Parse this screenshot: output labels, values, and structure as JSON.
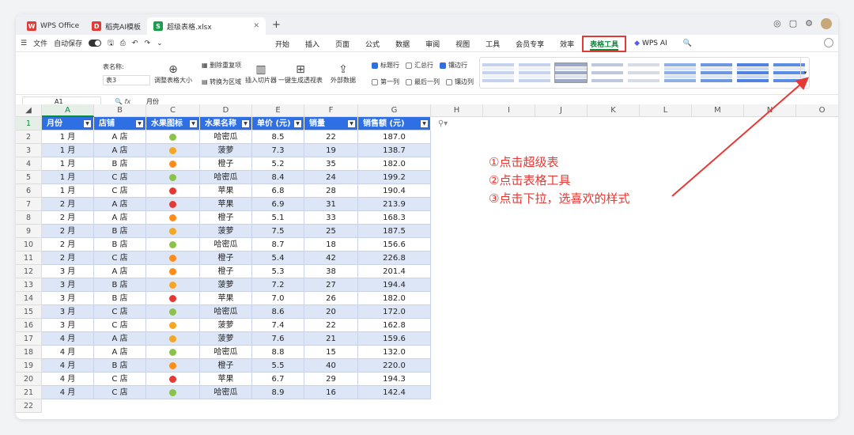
{
  "titlebar": {
    "tabs": [
      {
        "label": "WPS Office",
        "color": "#e53935",
        "logo": "W"
      },
      {
        "label": "稻壳AI模板",
        "color": "#e53935",
        "logo": "D"
      },
      {
        "label": "超级表格.xlsx",
        "color": "#1a9e4a",
        "logo": "S"
      }
    ]
  },
  "menubar": {
    "file": "文件",
    "autosave": "自动保存",
    "menus": [
      "开始",
      "插入",
      "页面",
      "公式",
      "数据",
      "审阅",
      "视图",
      "工具",
      "会员专享",
      "效率",
      "表格工具"
    ],
    "wps_ai": "WPS AI"
  },
  "ribbon": {
    "table_name_label": "表名称:",
    "table_name_value": "表3",
    "resize": "调整表格大小",
    "remove_dup": "删除重复项",
    "to_range": "转换为区域",
    "slicer": "插入切片器",
    "pivot": "一键生成透视表",
    "external": "外部数据",
    "header_row": "标题行",
    "total_row": "汇总行",
    "banded_rows": "镶边行",
    "first_col": "第一列",
    "last_col": "最后一列",
    "banded_cols": "镶边列"
  },
  "formula": {
    "cell_ref": "A1",
    "fx": "fx",
    "value": "月份"
  },
  "columns": [
    "A",
    "B",
    "C",
    "D",
    "E",
    "F",
    "G",
    "H",
    "I",
    "J",
    "K",
    "L",
    "M",
    "N",
    "O"
  ],
  "table": {
    "headers": [
      "月份",
      "店铺",
      "水果图标",
      "水果名称",
      "单价 (元)",
      "销量",
      "销售额 (元)"
    ],
    "rows": [
      [
        "1 月",
        "A 店",
        "pear",
        "哈密瓜",
        "8.5",
        "22",
        "187.0"
      ],
      [
        "1 月",
        "A 店",
        "pineapple",
        "菠萝",
        "7.3",
        "19",
        "138.7"
      ],
      [
        "1 月",
        "B 店",
        "orange",
        "橙子",
        "5.2",
        "35",
        "182.0"
      ],
      [
        "1 月",
        "C 店",
        "pear",
        "哈密瓜",
        "8.4",
        "24",
        "199.2"
      ],
      [
        "1 月",
        "C 店",
        "apple",
        "苹果",
        "6.8",
        "28",
        "190.4"
      ],
      [
        "2 月",
        "A 店",
        "apple",
        "苹果",
        "6.9",
        "31",
        "213.9"
      ],
      [
        "2 月",
        "A 店",
        "orange",
        "橙子",
        "5.1",
        "33",
        "168.3"
      ],
      [
        "2 月",
        "B 店",
        "pineapple",
        "菠萝",
        "7.5",
        "25",
        "187.5"
      ],
      [
        "2 月",
        "B 店",
        "pear",
        "哈密瓜",
        "8.7",
        "18",
        "156.6"
      ],
      [
        "2 月",
        "C 店",
        "orange",
        "橙子",
        "5.4",
        "42",
        "226.8"
      ],
      [
        "3 月",
        "A 店",
        "orange",
        "橙子",
        "5.3",
        "38",
        "201.4"
      ],
      [
        "3 月",
        "B 店",
        "pineapple",
        "菠萝",
        "7.2",
        "27",
        "194.4"
      ],
      [
        "3 月",
        "B 店",
        "apple",
        "苹果",
        "7.0",
        "26",
        "182.0"
      ],
      [
        "3 月",
        "C 店",
        "pear",
        "哈密瓜",
        "8.6",
        "20",
        "172.0"
      ],
      [
        "3 月",
        "C 店",
        "pineapple",
        "菠萝",
        "7.4",
        "22",
        "162.8"
      ],
      [
        "4 月",
        "A 店",
        "pineapple",
        "菠萝",
        "7.6",
        "21",
        "159.6"
      ],
      [
        "4 月",
        "A 店",
        "pear",
        "哈密瓜",
        "8.8",
        "15",
        "132.0"
      ],
      [
        "4 月",
        "B 店",
        "orange",
        "橙子",
        "5.5",
        "40",
        "220.0"
      ],
      [
        "4 月",
        "C 店",
        "apple",
        "苹果",
        "6.7",
        "29",
        "194.3"
      ],
      [
        "4 月",
        "C 店",
        "pear",
        "哈密瓜",
        "8.9",
        "16",
        "142.4"
      ]
    ]
  },
  "fruit_colors": {
    "pear": "#8bc34a",
    "pineapple": "#f5a623",
    "orange": "#ff8c1a",
    "apple": "#e53935"
  },
  "annotations": [
    "①点击超级表",
    "②点击表格工具",
    "③点击下拉，选喜欢的样式"
  ],
  "colors": {
    "accent": "#0a8a3a",
    "table_header": "#2f6fe4",
    "band": "#dce6f7",
    "annotation": "#e53935"
  }
}
